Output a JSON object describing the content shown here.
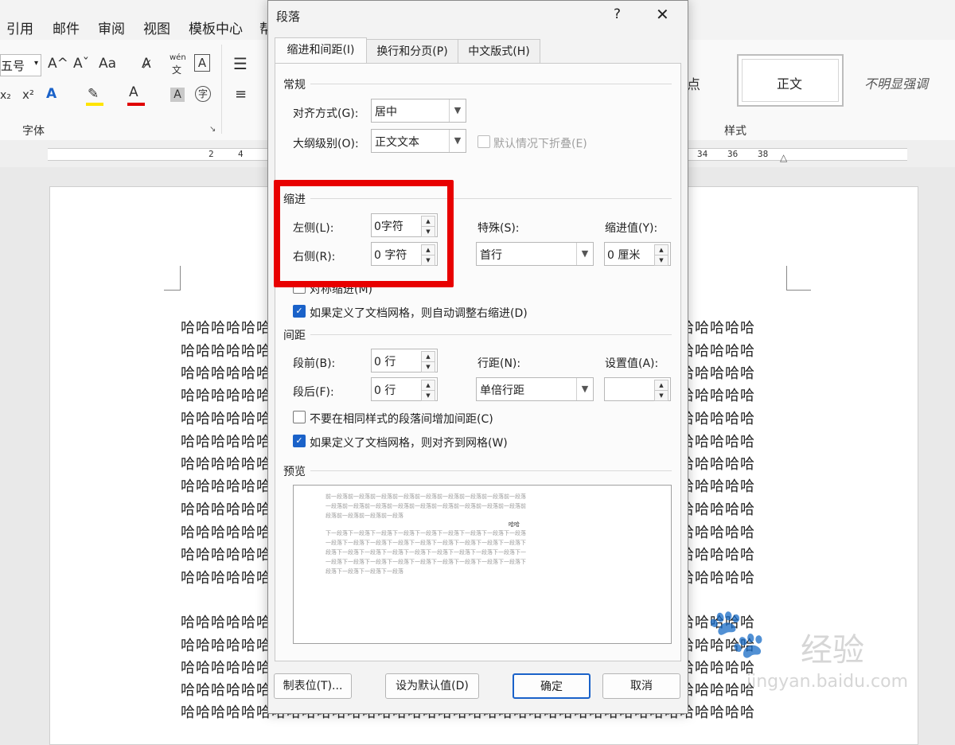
{
  "ribbon": {
    "tabs": [
      "引用",
      "邮件",
      "审阅",
      "视图",
      "模板中心",
      "帮"
    ],
    "font_size": "五号",
    "grow_font": "A^",
    "shrink_font": "Aˇ",
    "change_case": "Aa",
    "phonetic_top": "wén",
    "phonetic_bottom": "文",
    "font_group_label": "字体",
    "styles_group_label": "样式",
    "style_partial": "点",
    "style_normal": "正文",
    "style_subtle": "不明显强调"
  },
  "ruler_numbers": [
    "2",
    "4",
    "34",
    "36",
    "38"
  ],
  "document": {
    "line_text": "哈哈哈哈哈哈哈哈哈哈哈哈哈哈哈哈哈哈哈哈哈哈哈哈哈哈哈哈哈哈哈哈哈哈哈哈哈哈"
  },
  "dialog": {
    "title": "段落",
    "help": "?",
    "close": "✕",
    "tabs": [
      "缩进和间距(I)",
      "换行和分页(P)",
      "中文版式(H)"
    ],
    "general": {
      "heading": "常规",
      "alignment_label": "对齐方式(G):",
      "alignment_value": "居中",
      "outline_label": "大纲级别(O):",
      "outline_value": "正文文本",
      "collapse_label": "默认情况下折叠(E)"
    },
    "indent": {
      "heading": "缩进",
      "left_label": "左侧(L):",
      "left_value": "0字符",
      "right_label": "右侧(R):",
      "right_value": "0 字符",
      "special_label": "特殊(S):",
      "special_value": "首行",
      "by_label": "缩进值(Y):",
      "by_value": "0 厘米",
      "mirror_label": "对称缩进(M)",
      "auto_adjust_label": "如果定义了文档网格，则自动调整右缩进(D)"
    },
    "spacing": {
      "heading": "间距",
      "before_label": "段前(B):",
      "before_value": "0 行",
      "after_label": "段后(F):",
      "after_value": "0 行",
      "line_label": "行距(N):",
      "line_value": "单倍行距",
      "at_label": "设置值(A):",
      "at_value": "",
      "no_space_label": "不要在相同样式的段落间增加间距(C)",
      "snap_grid_label": "如果定义了文档网格，则对齐到网格(W)"
    },
    "preview": {
      "heading": "预览",
      "prev_lines": [
        "前一段落前一段落前一段落前一段落前一段落前一段落前一段落前一段落前一段落",
        "一段落前一段落前一段落前一段落前一段落前一段落前一段落前一段落前一段落前",
        "段落前一段落前一段落前一段落"
      ],
      "center_text": "哈哈",
      "next_lines": [
        "下一段落下一段落下一段落下一段落下一段落下一段落下一段落下一段落下一段落",
        "一段落下一段落下一段落下一段落下一段落下一段落下一段落下一段落下一段落下",
        "段落下一段落下一段落下一段落下一段落下一段落下一段落下一段落下一段落下一",
        "一段落下一段落下一段落下一段落下一段落下一段落下一段落下一段落下一段落下",
        "段落下一段落下一段落下一段落"
      ]
    },
    "buttons": {
      "tabs": "制表位(T)...",
      "set_default": "设为默认值(D)",
      "ok": "确定",
      "cancel": "取消"
    }
  },
  "watermark": {
    "brand": "经验",
    "url": "jingyan.baidu.com"
  }
}
